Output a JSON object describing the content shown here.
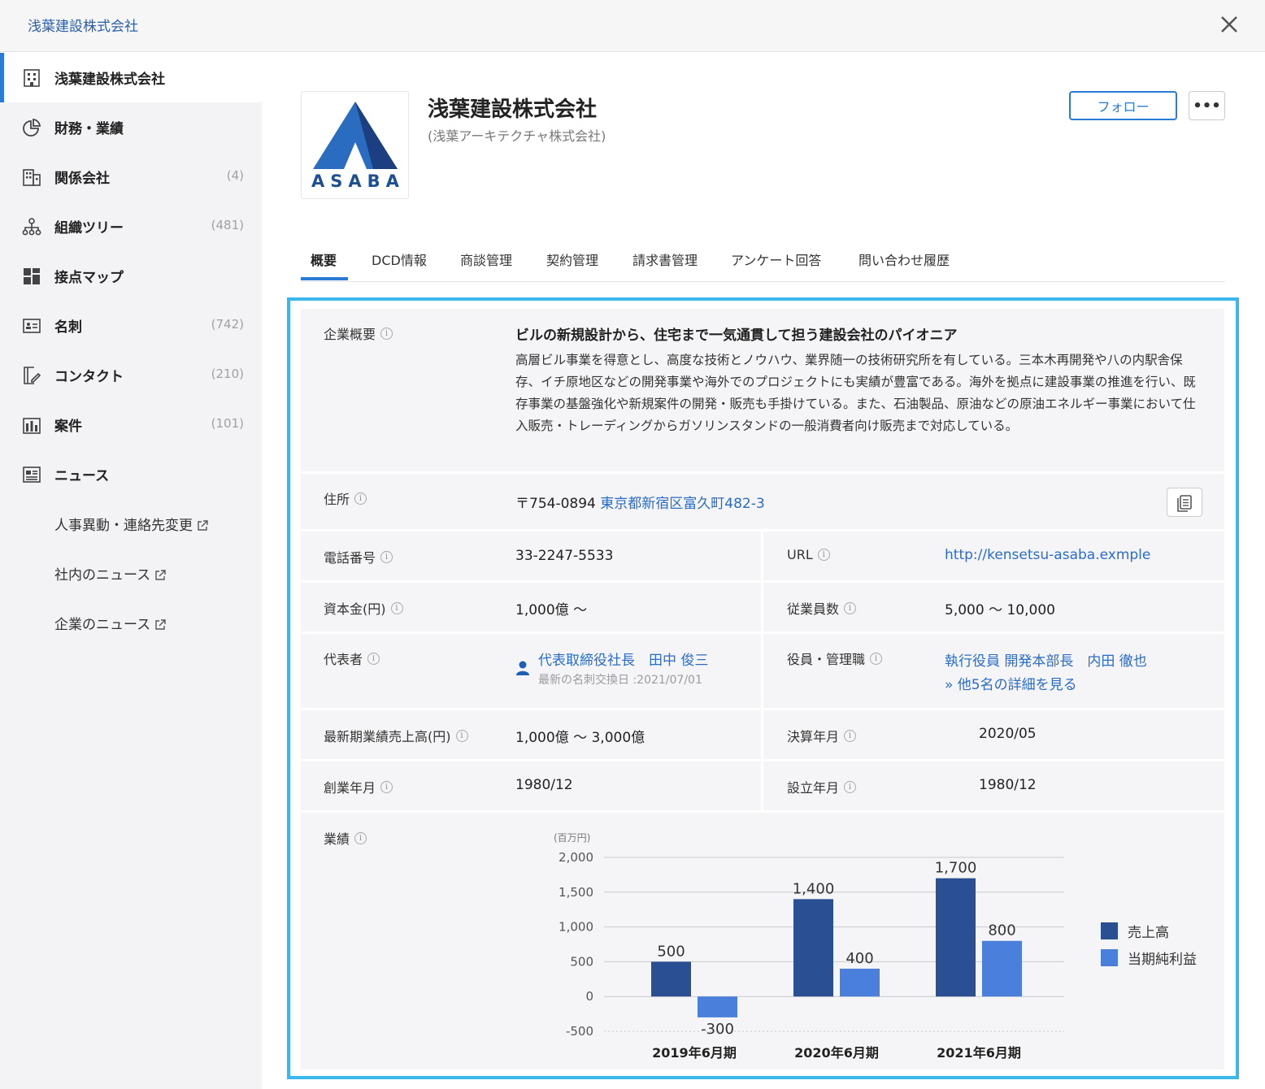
{
  "breadcrumb": "浅葉建設株式会社",
  "sidebar": {
    "items": [
      {
        "label": "浅葉建設株式会社",
        "count": "",
        "icon": "building-icon"
      },
      {
        "label": "財務・業績",
        "count": "",
        "icon": "pie-chart-icon"
      },
      {
        "label": "関係会社",
        "count": "(4)",
        "icon": "buildings-icon"
      },
      {
        "label": "組織ツリー",
        "count": "(481)",
        "icon": "org-tree-icon"
      },
      {
        "label": "接点マップ",
        "count": "",
        "icon": "grid-icon"
      },
      {
        "label": "名刺",
        "count": "(742)",
        "icon": "business-card-icon"
      },
      {
        "label": "コンタクト",
        "count": "(210)",
        "icon": "contact-edit-icon"
      },
      {
        "label": "案件",
        "count": "(101)",
        "icon": "deal-chart-icon"
      },
      {
        "label": "ニュース",
        "count": "",
        "icon": "news-icon"
      }
    ],
    "sub_items": [
      {
        "label": "人事異動・連絡先変更"
      },
      {
        "label": "社内のニュース"
      },
      {
        "label": "企業のニュース"
      }
    ]
  },
  "company": {
    "name": "浅葉建設株式会社",
    "sub_name": "(浅葉アーキテクチャ株式会社)",
    "logo_text": "ASABA",
    "follow_label": "フォロー",
    "more_label": "•••"
  },
  "tabs": [
    "概要",
    "DCD情報",
    "商談管理",
    "契約管理",
    "請求書管理",
    "アンケート回答",
    "問い合わせ履歴"
  ],
  "overview": {
    "label": "企業概要",
    "headline": "ビルの新規設計から、住宅まで一気通貫して担う建設会社のパイオニア",
    "description": "高層ビル事業を得意とし、高度な技術とノウハウ、業界随一の技術研究所を有している。三本木再開発や八の内駅舎保存、イチ原地区などの開発事業や海外でのプロジェクトにも実績が豊富である。海外を拠点に建設事業の推進を行い、既存事業の基盤強化や新規案件の開発・販売も手掛けている。また、石油製品、原油などの原油エネルギー事業において仕入販売・トレーディングからガソリンスタンドの一般消費者向け販売まで対応している。"
  },
  "fields": {
    "address_label": "住所",
    "postal": "〒754-0894",
    "address": "東京都新宿区富久町482-3",
    "phone_label": "電話番号",
    "phone": "33-2247-5533",
    "url_label": "URL",
    "url": "http://kensetsu-asaba.exmple",
    "capital_label": "資本金(円)",
    "capital": "1,000億 ～",
    "employees_label": "従業員数",
    "employees": "5,000 ～ 10,000",
    "rep_label": "代表者",
    "rep_name": "代表取締役社長　田中 俊三",
    "rep_note": "最新の名刺交換日 :2021/07/01",
    "officers_label": "役員・管理職",
    "officer_name": "執行役員 開発本部長　内田 徹也",
    "officer_more": "» 他5名の詳細を見る",
    "sales_label": "最新期業績売上高(円)",
    "sales": "1,000億 ～ 3,000億",
    "fiscal_label": "決算年月",
    "fiscal": "2020/05",
    "founded_label": "創業年月",
    "founded": "1980/12",
    "established_label": "設立年月",
    "established": "1980/12",
    "results_label": "業績"
  },
  "colors": {
    "accent": "#2a7bd6",
    "panel_border": "#3ab8ec",
    "sales_bar": "#2a4f93",
    "profit_bar": "#4a80dc"
  },
  "chart_data": {
    "type": "bar",
    "unit_label": "(百万円)",
    "categories": [
      "2019年6月期",
      "2020年6月期",
      "2021年6月期"
    ],
    "series": [
      {
        "name": "売上高",
        "values": [
          500,
          1400,
          1700
        ]
      },
      {
        "name": "当期純利益",
        "values": [
          -300,
          400,
          800
        ]
      }
    ],
    "yticks": [
      "2,000",
      "1,500",
      "1,000",
      "500",
      "0",
      "-500"
    ],
    "ylim": [
      -500,
      2000
    ],
    "legend": "right"
  }
}
